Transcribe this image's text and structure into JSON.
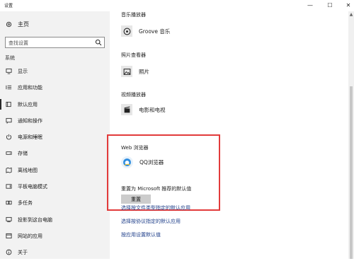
{
  "window": {
    "title": "设置",
    "min": "—",
    "max": "☐",
    "close": "✕"
  },
  "sidebar": {
    "home": "主页",
    "search_placeholder": "查找设置",
    "section": "系统",
    "items": [
      {
        "label": "显示",
        "icon": "monitor-icon"
      },
      {
        "label": "应用和功能",
        "icon": "list-icon"
      },
      {
        "label": "默认应用",
        "icon": "default-apps-icon"
      },
      {
        "label": "通知和操作",
        "icon": "notification-icon"
      },
      {
        "label": "电源和睡眠",
        "icon": "power-icon"
      },
      {
        "label": "存储",
        "icon": "storage-icon"
      },
      {
        "label": "离线地图",
        "icon": "map-icon"
      },
      {
        "label": "平板电脑模式",
        "icon": "tablet-icon"
      },
      {
        "label": "多任务",
        "icon": "multitask-icon"
      },
      {
        "label": "投影到这台电脑",
        "icon": "project-icon"
      },
      {
        "label": "网站的应用",
        "icon": "web-apps-icon"
      },
      {
        "label": "关于",
        "icon": "info-icon"
      }
    ],
    "active_item": "默认应用"
  },
  "main": {
    "music": {
      "title": "音乐播放器",
      "app": "Groove 音乐"
    },
    "photo": {
      "title": "照片查看器",
      "app": "照片"
    },
    "video": {
      "title": "视频播放器",
      "app": "电影和电视"
    },
    "web": {
      "title": "Web 浏览器",
      "app": "QQ浏览器"
    },
    "reset": {
      "text": "重置为 Microsoft 推荐的默认值",
      "button": "重置"
    },
    "links": [
      "选择按文件类型指定的默认应用",
      "选择按协议指定的默认应用",
      "按应用设置默认值"
    ]
  },
  "colors": {
    "sidebar_bg": "#f2f2f2",
    "highlight_border": "#e23b3b",
    "link": "#1f3f8a",
    "button_bg": "#cccccc"
  }
}
